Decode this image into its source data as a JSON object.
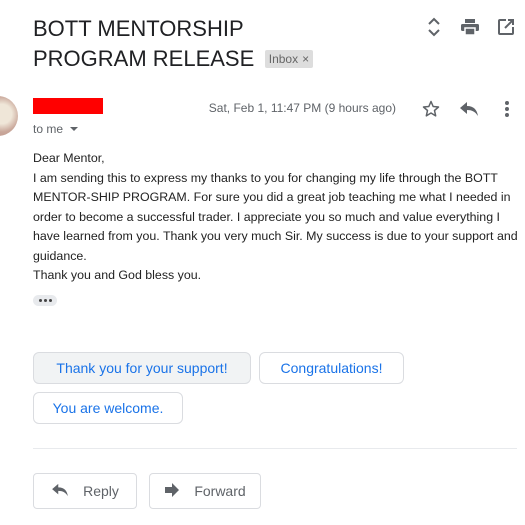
{
  "subject": {
    "text": "BOTT MENTORSHIP PROGRAM RELEASE",
    "label": "Inbox",
    "label_close": "×"
  },
  "top_icons": [
    "expand-collapse-icon",
    "print-icon",
    "open-in-new-window-icon"
  ],
  "message": {
    "recipient": "to me",
    "date": "Sat, Feb 1, 11:47 PM (9 hours ago)",
    "icons": [
      "star-icon",
      "reply-icon",
      "more-vert-icon"
    ],
    "body": {
      "greeting": "Dear Mentor,",
      "paragraph": "I am sending this to express my thanks to you for changing my life through the BOTT MENTOR-SHIP PROGRAM. For sure you did a great job teaching me what I needed in order to become a successful trader. I appreciate you so much and value everything I have learned from you. Thank you very much Sir. My success is due to your support and guidance.",
      "closing": "Thank you and God bless you."
    }
  },
  "smart_replies": [
    "Thank you for your support!",
    "Congratulations!",
    "You are welcome."
  ],
  "actions": {
    "reply": "Reply",
    "forward": "Forward"
  },
  "colors": {
    "link_blue": "#1a73e8",
    "redaction": "#ff0000",
    "muted_gray": "#5f6368"
  }
}
